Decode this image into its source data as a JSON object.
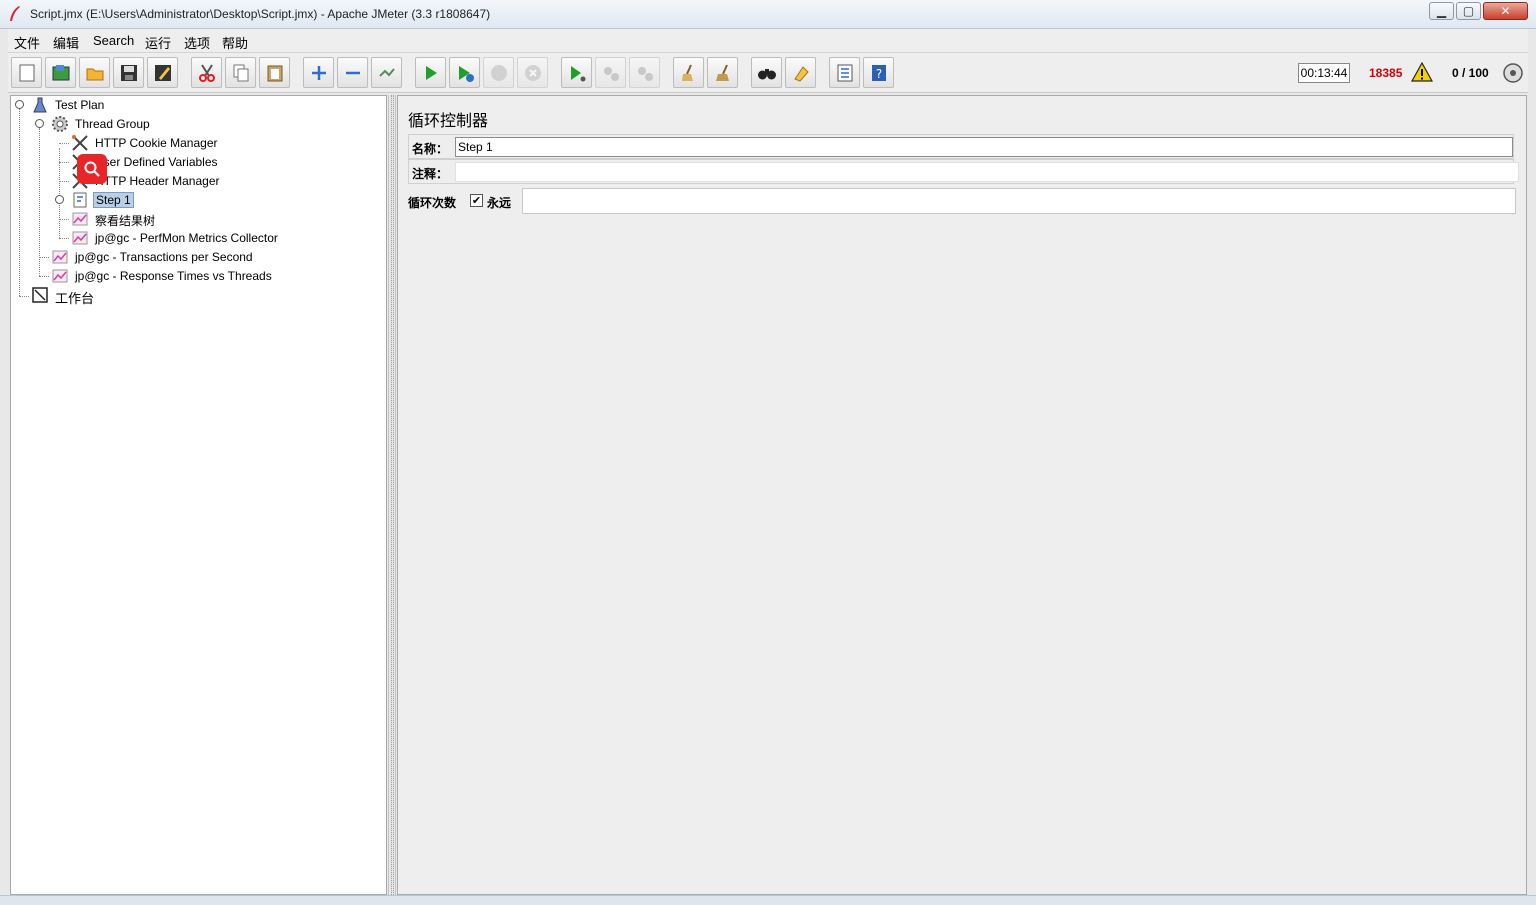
{
  "window": {
    "title": "Script.jmx (E:\\Users\\Administrator\\Desktop\\Script.jmx) - Apache JMeter (3.3 r1808647)"
  },
  "menu": [
    "文件",
    "编辑",
    "Search",
    "运行",
    "选项",
    "帮助"
  ],
  "toolbar": {
    "timer": "00:13:44",
    "error_count": "18385",
    "threads": "0 / 100"
  },
  "tree": {
    "test_plan": "Test Plan",
    "thread_group": "Thread Group",
    "cookie_manager": "HTTP Cookie Manager",
    "user_vars": "User Defined Variables",
    "header_manager": "HTTP Header Manager",
    "step1": "Step 1",
    "results_tree": "察看结果树",
    "perfmon": "jp@gc - PerfMon Metrics Collector",
    "tps": "jp@gc - Transactions per Second",
    "rt_threads": "jp@gc - Response Times vs Threads",
    "workbench": "工作台"
  },
  "panel": {
    "title": "循环控制器",
    "name_label": "名称：",
    "name_value": "Step 1",
    "comment_label": "注释：",
    "comment_value": "",
    "loop_label": "循环次数",
    "forever_label": "永远",
    "forever_checked": "✔",
    "loop_value": ""
  }
}
